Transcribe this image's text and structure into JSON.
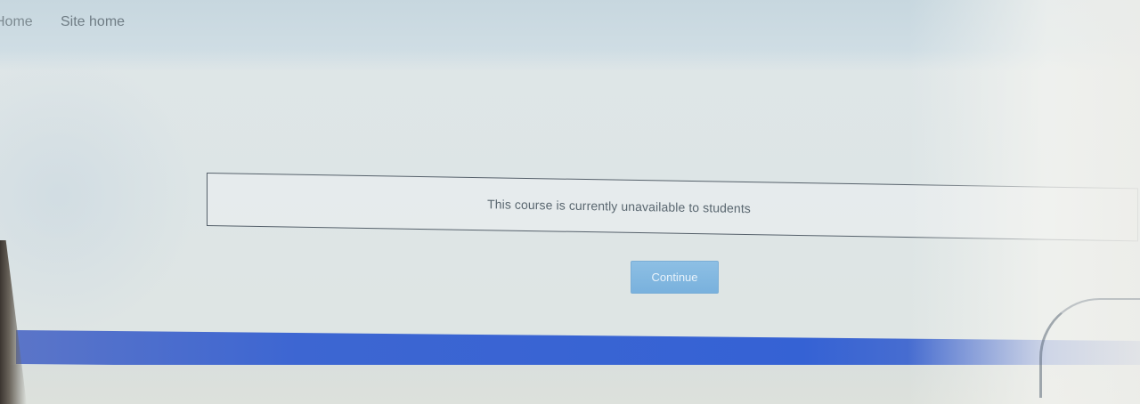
{
  "nav": {
    "home_label": "Home",
    "site_home_label": "Site home"
  },
  "notice": {
    "message": "This course is currently unavailable to students"
  },
  "actions": {
    "continue_label": "Continue"
  },
  "colors": {
    "button_background": "#79b1dd",
    "footer_band": "#3562d4",
    "notice_border": "#55606a"
  }
}
